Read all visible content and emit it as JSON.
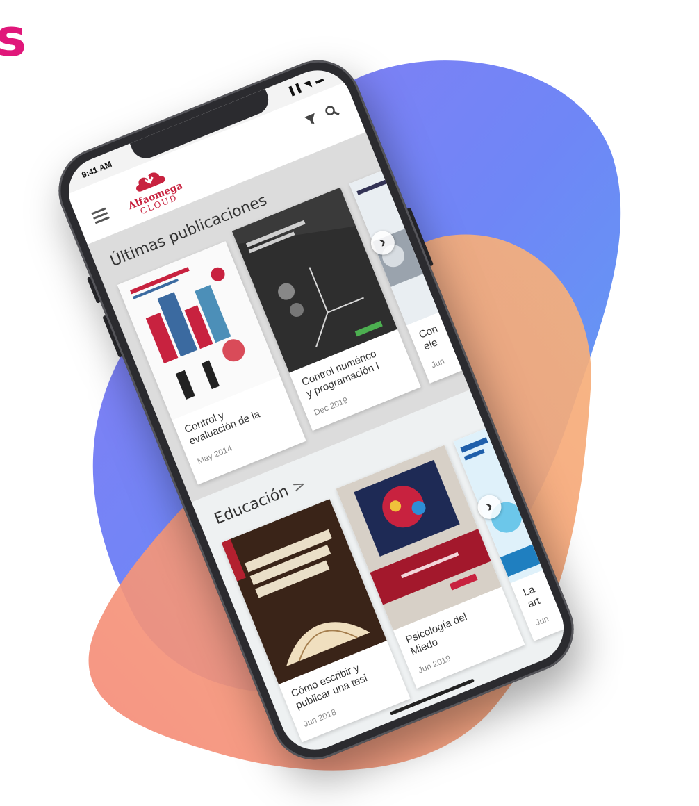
{
  "corner_text": "s",
  "status": {
    "time": "9:41 AM",
    "icons": "▐▐ ◥ ▬"
  },
  "app": {
    "logo_line1": "Alfaomega",
    "logo_line2": "CLOUD"
  },
  "sections": [
    {
      "title": "Últimas publicaciones",
      "books": [
        {
          "title1": "Control y",
          "title2": "evaluación de la",
          "date": "May 2014"
        },
        {
          "title1": "Control numérico",
          "title2": "y programación I",
          "date": "Dec 2019"
        },
        {
          "title1": "Con",
          "title2": "ele",
          "date": "Jun"
        }
      ]
    },
    {
      "title": "Educación",
      "chevron": ">",
      "books": [
        {
          "title1": "Cómo escribir y",
          "title2": "publicar una tesi",
          "date": "Jun 2018"
        },
        {
          "title1": "Psicología del",
          "title2": "Miedo",
          "date": "Jun 2019"
        },
        {
          "title1": "La",
          "title2": "art",
          "date": "Jun"
        }
      ]
    }
  ],
  "next_glyph": "›",
  "colors": {
    "brand": "#c8223f",
    "accent": "#e0177a",
    "blob_blue": "#6f7ff5",
    "blob_orange": "#f7a06a"
  }
}
